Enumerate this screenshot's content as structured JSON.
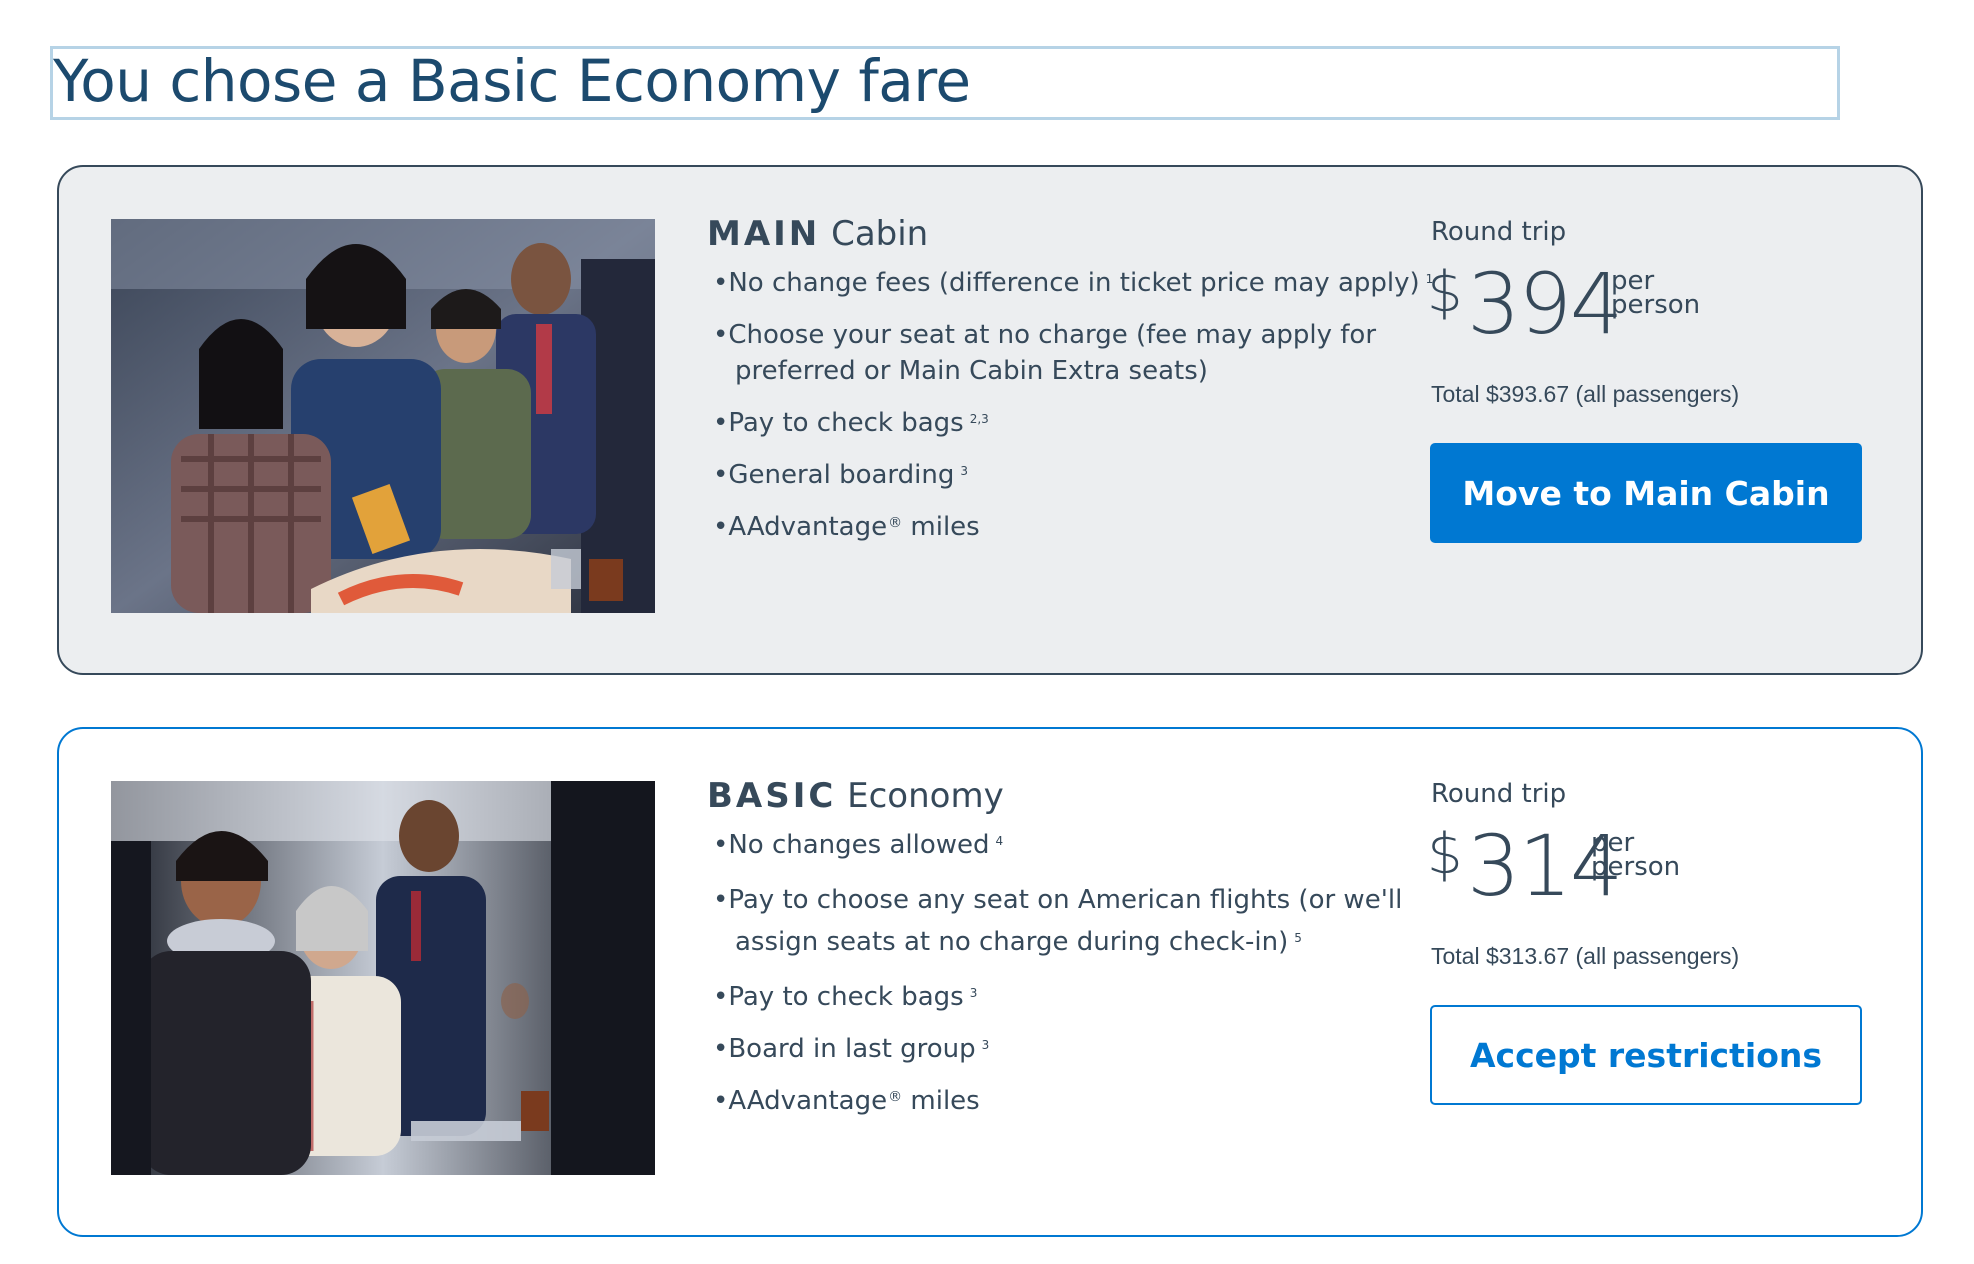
{
  "page": {
    "title": "You chose a Basic Economy fare"
  },
  "colors": {
    "accent": "#0078d2",
    "text": "#36495a",
    "title": "#1c4a6e",
    "main_card_bg": "#eceef0"
  },
  "fares": {
    "main": {
      "name_strong": "MAIN",
      "name_rest": " Cabin",
      "photo_icon": "cabin-photo-main",
      "features": [
        {
          "text": "No change fees (difference in ticket price may apply)",
          "note": "1"
        },
        {
          "text": "Choose your seat at no charge (fee may apply for",
          "text2": "preferred or Main Cabin Extra seats)"
        },
        {
          "text": "Pay to check bags",
          "note": "2,3"
        },
        {
          "text": "General boarding",
          "note": "3"
        },
        {
          "text": "AAdvantage",
          "reg": "®",
          "text2": " miles"
        }
      ],
      "trip_type": "Round trip",
      "currency": "$",
      "price": "394",
      "per": "per",
      "person": "person",
      "total": "Total $393.67 (all passengers)",
      "button_label": "Move to Main Cabin"
    },
    "basic": {
      "name_strong": "BASIC",
      "name_rest": " Economy",
      "photo_icon": "cabin-photo-basic",
      "features": [
        {
          "text": "No changes allowed",
          "note": "4"
        },
        {
          "text": "Pay to choose any seat on American flights (or we'll",
          "text2": "assign seats at no charge during check-in)",
          "note": "5"
        },
        {
          "text": "Pay to check bags",
          "note": "3"
        },
        {
          "text": "Board in last group",
          "note": "3"
        },
        {
          "text": "AAdvantage",
          "reg": "®",
          "text2": " miles"
        }
      ],
      "trip_type": "Round trip",
      "currency": "$",
      "price": "314",
      "per": "per",
      "person": "person",
      "total": "Total $313.67 (all passengers)",
      "button_label": "Accept restrictions"
    }
  }
}
